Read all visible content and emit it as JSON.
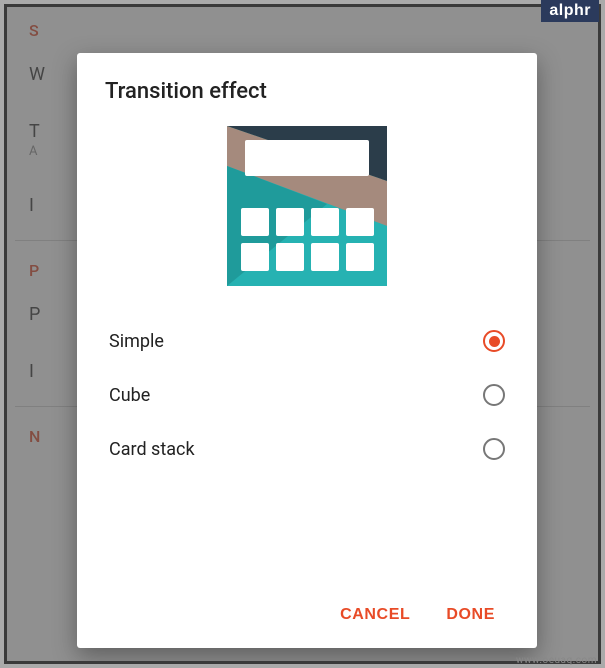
{
  "badge": "alphr",
  "watermark": "www.oeuaq.com",
  "dialog": {
    "title": "Transition effect",
    "options": [
      {
        "label": "Simple",
        "selected": true
      },
      {
        "label": "Cube",
        "selected": false
      },
      {
        "label": "Card stack",
        "selected": false
      }
    ],
    "cancel": "CANCEL",
    "done": "DONE"
  },
  "colors": {
    "accent": "#e84b27",
    "preview_teal": "#26b2b2",
    "preview_dark": "#2b3d4a",
    "preview_tan": "#a58a7d"
  },
  "background": {
    "section1": "S",
    "row1": "W",
    "row2": "T",
    "row2sub": "A",
    "row3": "I",
    "section2": "P",
    "row4": "P",
    "row5": "I",
    "section3": "N"
  }
}
